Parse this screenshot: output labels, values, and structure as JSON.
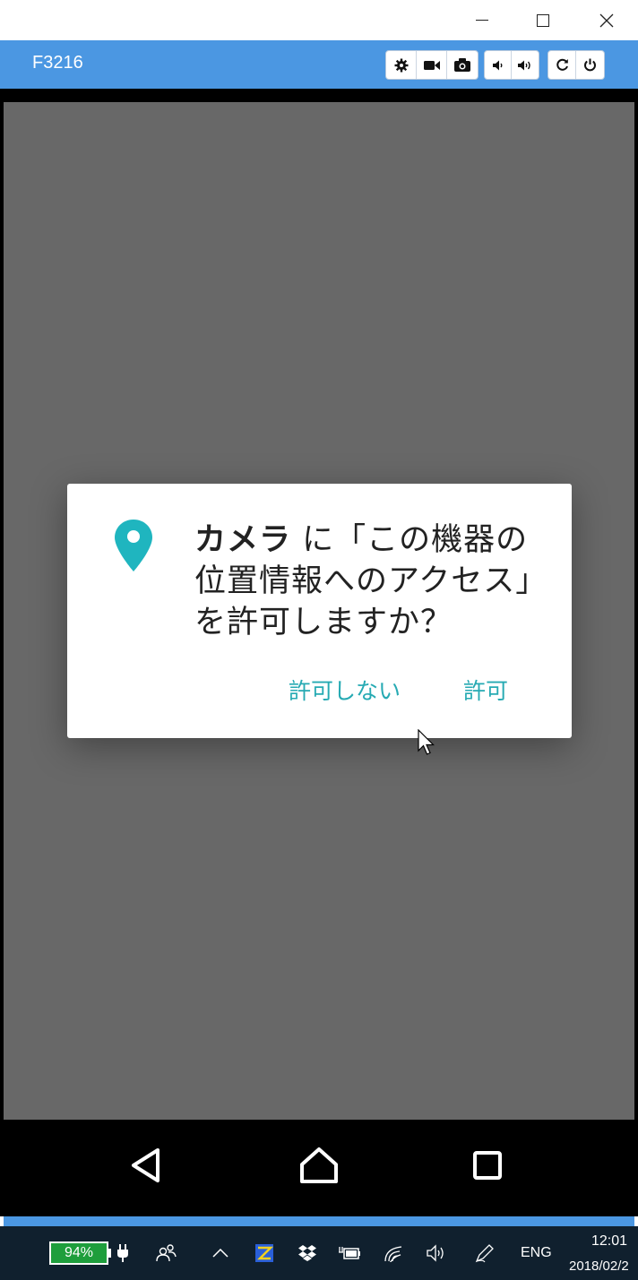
{
  "window": {
    "title": "F3216",
    "toolbar": {
      "icons": [
        "gear-icon",
        "video-camera-icon",
        "camera-icon",
        "volume-down-icon",
        "volume-up-icon",
        "rotate-icon",
        "power-icon"
      ]
    }
  },
  "dialog": {
    "app_name": "カメラ",
    "message_rest": " に「この機器の位置情報へのアクセス」を許可しますか？",
    "deny_label": "許可しない",
    "allow_label": "許可",
    "icon": "location-pin-icon",
    "accent_color": "#26aab3"
  },
  "navbar": {
    "icons": [
      "back-icon",
      "home-icon",
      "recent-apps-icon"
    ]
  },
  "taskbar": {
    "battery": "94%",
    "language": "ENG",
    "time": "12:01",
    "date": "2018/02/2"
  }
}
